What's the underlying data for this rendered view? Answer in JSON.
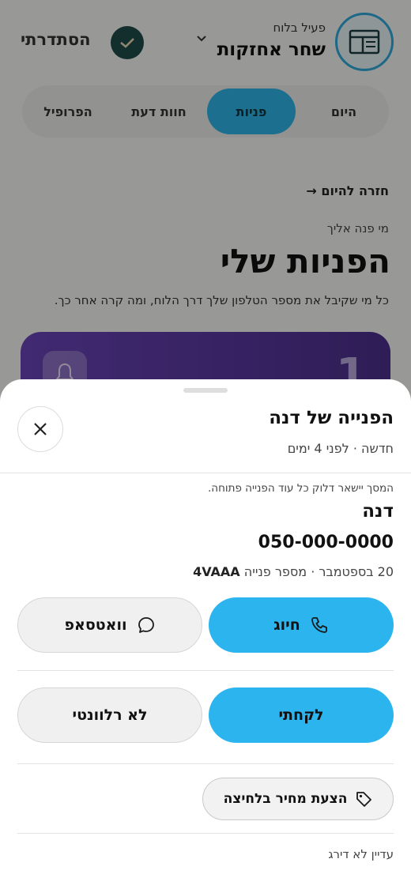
{
  "header": {
    "status": "פעיל בלוח",
    "business_name": "שחר אחזקות",
    "done_label": "הסתדרתי"
  },
  "tabs": [
    {
      "label": "היום",
      "active": false
    },
    {
      "label": "פניות",
      "active": true
    },
    {
      "label": "חוות דעת",
      "active": false
    },
    {
      "label": "הפרופיל",
      "active": false
    }
  ],
  "page": {
    "back_link": "חזרה להיום",
    "eyebrow": "מי פנה אליך",
    "title": "הפניות שלי",
    "description": "כל מי שקיבל את מספר הטלפון שלך דרך הלוח, ומה קרה אחר כך.",
    "card_number": "1"
  },
  "sheet": {
    "title": "הפנייה של דנה",
    "subtitle": "חדשה · לפני 4 ימים",
    "note": "המסך יישאר דלוק כל עוד הפנייה פתוחה.",
    "contact_name": "דנה",
    "phone": "050-000-0000",
    "meta_prefix": "20 בספטמבר · מספר פנייה",
    "request_id": "4VAAA",
    "call_label": "חיוג",
    "whatsapp_label": "וואטסאפ",
    "took_label": "לקחתי",
    "irrelevant_label": "לא רלוונטי",
    "quote_label": "הצעת מחיר בלחיצה",
    "rating_status": "עדיין לא דירג"
  },
  "colors": {
    "accent": "#2cb4ef",
    "active_tab": "#2eb3e6",
    "done_badge": "#1f4c4a",
    "card_gradient_start": "#6b44b8",
    "card_gradient_end": "#4b2f8c"
  },
  "icons": {
    "logo": "dashboard-icon",
    "done": "check-icon",
    "close": "close-icon",
    "call": "phone-icon",
    "whatsapp": "chat-bubble-icon",
    "quote": "tag-icon",
    "card": "bell-icon"
  }
}
